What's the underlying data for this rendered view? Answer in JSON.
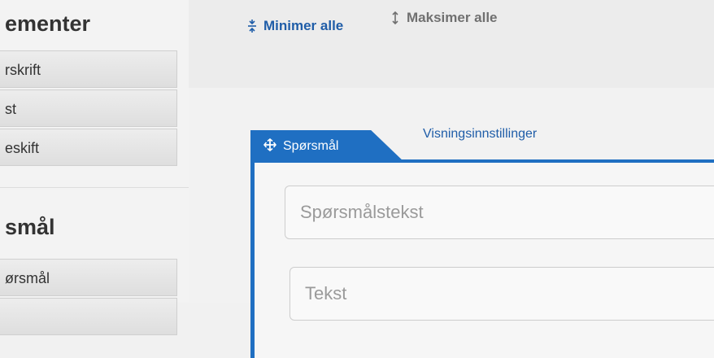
{
  "sidebar": {
    "group1_title": "ementer",
    "items": [
      {
        "label": "rskrift"
      },
      {
        "label": "st"
      },
      {
        "label": "eskift"
      }
    ],
    "group2_title": "smål",
    "group2_items": [
      {
        "label": "ørsmål"
      }
    ]
  },
  "toolbar": {
    "minimize_label": "Minimer alle",
    "maximize_label": "Maksimer alle"
  },
  "tabs": {
    "active_label": "Spørsmål",
    "inactive_label": "Visningsinnstillinger"
  },
  "form": {
    "question_placeholder": "Spørsmålstekst",
    "text_placeholder": "Tekst"
  },
  "colors": {
    "accent": "#1f6fc2",
    "link": "#1f5da8"
  },
  "icons": {
    "minimize": "collapse-arrows-icon",
    "maximize": "expand-arrows-icon",
    "move": "move-icon"
  }
}
